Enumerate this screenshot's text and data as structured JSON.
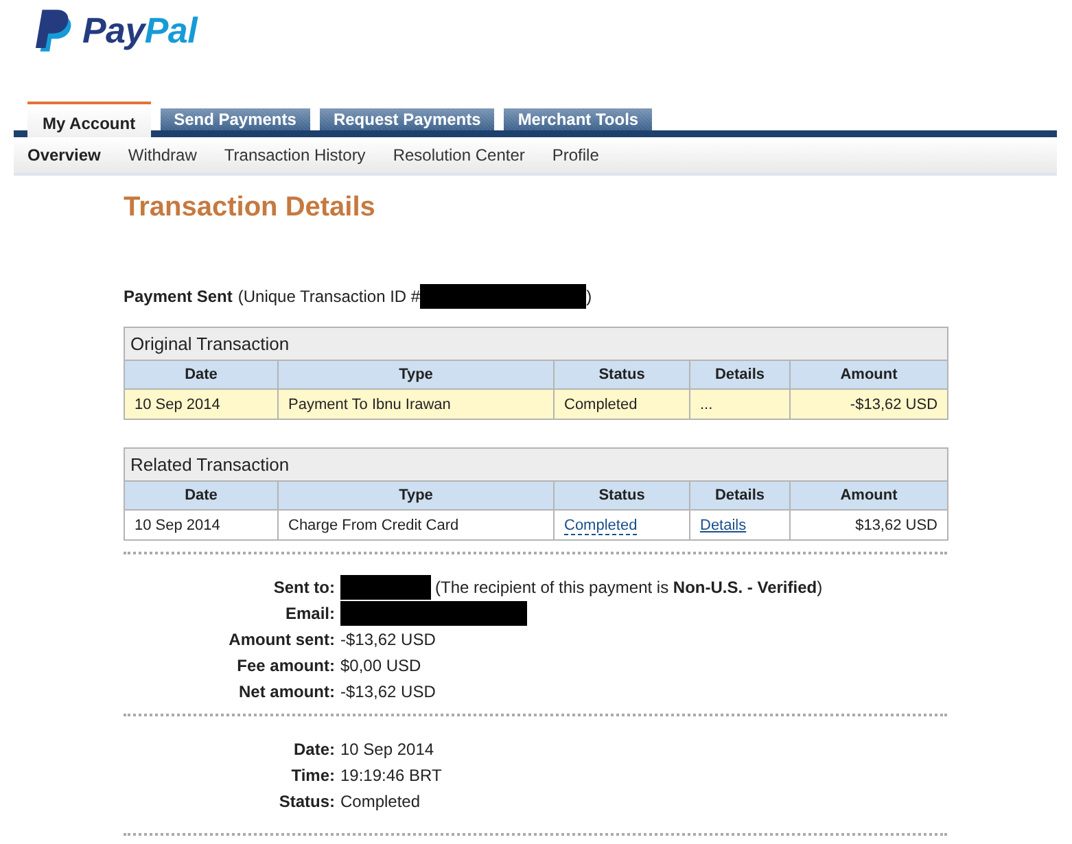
{
  "logo": {
    "text_dark": "Pay",
    "text_light": "Pal"
  },
  "tabs": [
    {
      "label": "My Account",
      "selected": true
    },
    {
      "label": "Send Payments",
      "selected": false
    },
    {
      "label": "Request Payments",
      "selected": false
    },
    {
      "label": "Merchant Tools",
      "selected": false
    }
  ],
  "subnav": [
    {
      "label": "Overview",
      "selected": true
    },
    {
      "label": "Withdraw",
      "selected": false
    },
    {
      "label": "Transaction History",
      "selected": false
    },
    {
      "label": "Resolution Center",
      "selected": false
    },
    {
      "label": "Profile",
      "selected": false
    }
  ],
  "page_title": "Transaction Details",
  "payment_sent": {
    "label": "Payment Sent",
    "prefix": "(Unique Transaction ID #",
    "id_redacted": true,
    "suffix": ")"
  },
  "tables": [
    {
      "caption": "Original Transaction",
      "columns": [
        "Date",
        "Type",
        "Status",
        "Details",
        "Amount"
      ],
      "rows": [
        {
          "highlighted": true,
          "date": "10 Sep 2014",
          "type": "Payment To Ibnu Irawan",
          "status": {
            "text": "Completed",
            "kind": "plain"
          },
          "details": {
            "text": "...",
            "kind": "muted"
          },
          "amount": "-$13,62 USD"
        }
      ]
    },
    {
      "caption": "Related Transaction",
      "columns": [
        "Date",
        "Type",
        "Status",
        "Details",
        "Amount"
      ],
      "rows": [
        {
          "highlighted": false,
          "date": "10 Sep 2014",
          "type": "Charge From Credit Card",
          "status": {
            "text": "Completed",
            "kind": "tooltip"
          },
          "details": {
            "text": "Details",
            "kind": "link"
          },
          "amount": "$13,62 USD"
        }
      ]
    }
  ],
  "sections": [
    {
      "rows": [
        {
          "label": "Sent to:",
          "kind": "redacted-short",
          "note": "(The recipient of this payment is **Non-U.S. - Verified**)"
        },
        {
          "label": "Email:",
          "kind": "redacted-long"
        },
        {
          "label": "Amount sent:",
          "kind": "text",
          "value": "-$13,62 USD"
        },
        {
          "label": "Fee amount:",
          "kind": "text",
          "value": "$0,00 USD"
        },
        {
          "label": "Net amount:",
          "kind": "text",
          "value": "-$13,62 USD"
        }
      ]
    },
    {
      "rows": [
        {
          "label": "Date:",
          "kind": "text",
          "value": "10 Sep 2014"
        },
        {
          "label": "Time:",
          "kind": "text",
          "value": "19:19:46 BRT"
        },
        {
          "label": "Status:",
          "kind": "text",
          "value": "Completed"
        }
      ]
    }
  ]
}
